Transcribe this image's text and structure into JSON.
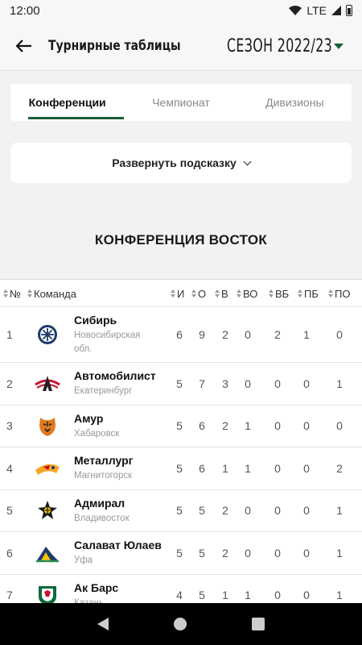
{
  "status": {
    "time": "12:00",
    "network": "LTE"
  },
  "appbar": {
    "title": "Турнирные таблицы",
    "season": "СЕЗОН 2022/23"
  },
  "tabs": [
    {
      "label": "Конференции",
      "active": true
    },
    {
      "label": "Чемпионат",
      "active": false
    },
    {
      "label": "Дивизионы",
      "active": false
    }
  ],
  "hint": {
    "label": "Развернуть подсказку"
  },
  "conference_title": "КОНФЕРЕНЦИЯ ВОСТОК",
  "columns": [
    "№",
    "Команда",
    "И",
    "О",
    "В",
    "ВО",
    "ВБ",
    "ПБ",
    "ПО"
  ],
  "rows": [
    {
      "num": "1",
      "team": "Сибирь",
      "city": "Новосибирская обл.",
      "logo": "sibir-logo",
      "vals": [
        "6",
        "9",
        "2",
        "0",
        "2",
        "1",
        "0"
      ]
    },
    {
      "num": "2",
      "team": "Автомобилист",
      "city": "Екатеринбург",
      "logo": "avtomobilist-logo",
      "vals": [
        "5",
        "7",
        "3",
        "0",
        "0",
        "0",
        "1"
      ]
    },
    {
      "num": "3",
      "team": "Амур",
      "city": "Хабаровск",
      "logo": "amur-logo",
      "vals": [
        "5",
        "6",
        "2",
        "1",
        "0",
        "0",
        "0"
      ]
    },
    {
      "num": "4",
      "team": "Металлург",
      "city": "Магнитогорск",
      "logo": "metallurg-logo",
      "vals": [
        "5",
        "6",
        "1",
        "1",
        "0",
        "0",
        "2"
      ]
    },
    {
      "num": "5",
      "team": "Адмирал",
      "city": "Владивосток",
      "logo": "admiral-logo",
      "vals": [
        "5",
        "5",
        "2",
        "0",
        "0",
        "0",
        "1"
      ]
    },
    {
      "num": "6",
      "team": "Салават Юлаев",
      "city": "Уфа",
      "logo": "salavat-logo",
      "vals": [
        "5",
        "5",
        "2",
        "0",
        "0",
        "0",
        "1"
      ]
    },
    {
      "num": "7",
      "team": "Ак Барс",
      "city": "Казань",
      "logo": "akbars-logo",
      "vals": [
        "4",
        "5",
        "1",
        "1",
        "0",
        "0",
        "1"
      ]
    }
  ],
  "colors": {
    "accent": "#1a5c3a"
  }
}
